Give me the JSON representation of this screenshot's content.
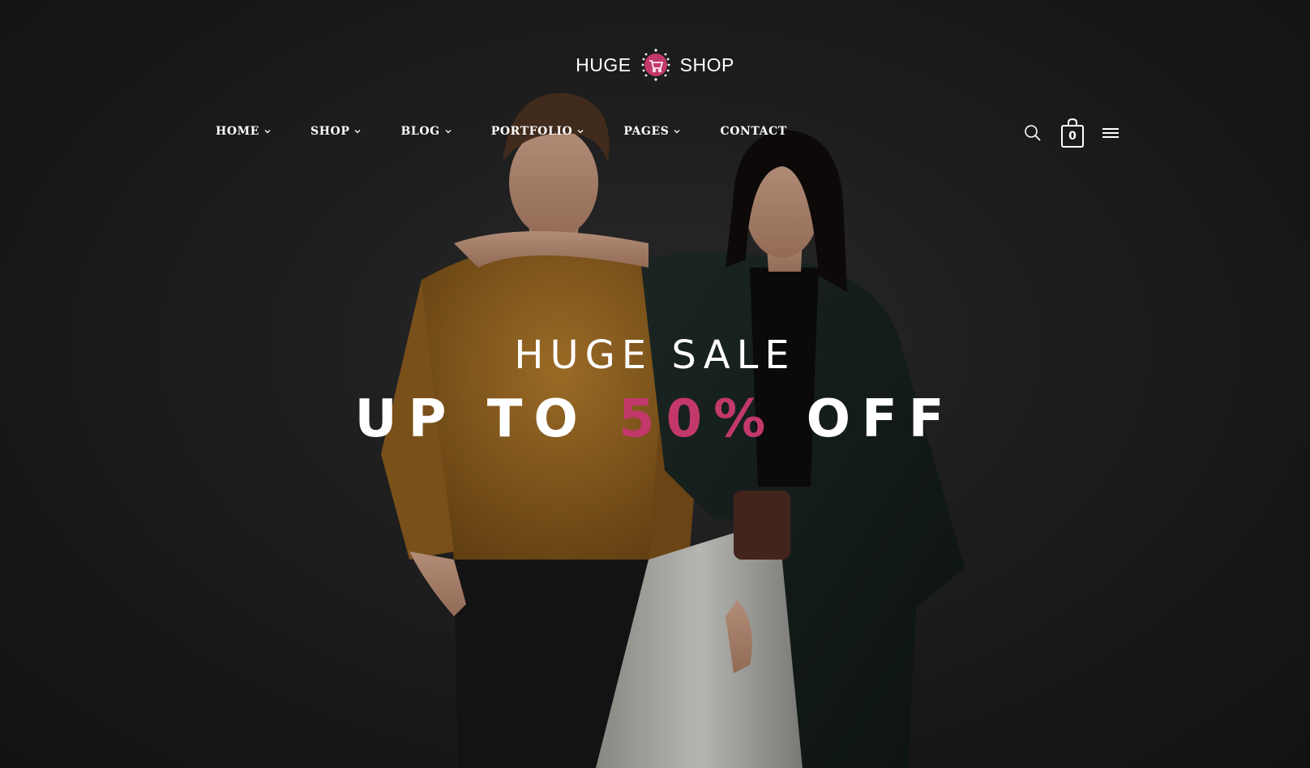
{
  "brand": {
    "word_left": "HUGE",
    "word_right": "SHOP",
    "accent_color": "#c2386b"
  },
  "nav": {
    "items": [
      {
        "label": "HOME",
        "has_dropdown": true
      },
      {
        "label": "SHOP",
        "has_dropdown": true
      },
      {
        "label": "BLOG",
        "has_dropdown": true
      },
      {
        "label": "PORTFOLIO",
        "has_dropdown": true
      },
      {
        "label": "PAGES",
        "has_dropdown": true
      },
      {
        "label": "CONTACT",
        "has_dropdown": false
      }
    ]
  },
  "tools": {
    "search_icon": "search-icon",
    "cart_icon": "shopping-bag-icon",
    "cart_count": "0",
    "menu_icon": "hamburger-menu-icon"
  },
  "hero": {
    "headline": "HUGE SALE",
    "offer_prefix": "UP TO",
    "offer_value": "50%",
    "offer_suffix": "OFF"
  }
}
